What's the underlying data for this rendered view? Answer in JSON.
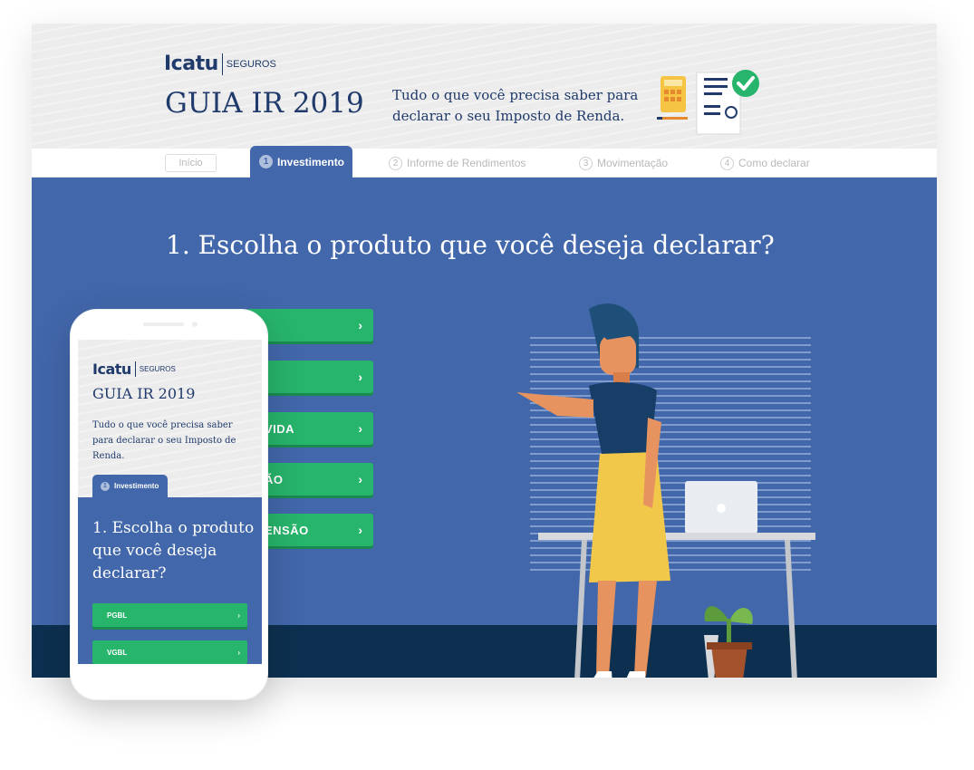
{
  "brand": {
    "name": "Icatu",
    "sub": "SEGUROS"
  },
  "header": {
    "title": "GUIA IR 2019",
    "tagline_line1": "Tudo o que você precisa saber para",
    "tagline_line2": "declarar o seu Imposto de Renda."
  },
  "nav": {
    "inicio": "Início",
    "steps": [
      {
        "num": "1",
        "label": "Investimento",
        "active": true
      },
      {
        "num": "2",
        "label": "Informe de Rendimentos",
        "active": false
      },
      {
        "num": "3",
        "label": "Movimentação",
        "active": false
      },
      {
        "num": "4",
        "label": "Como declarar",
        "active": false
      }
    ]
  },
  "main": {
    "question": "1. Escolha o produto que você deseja declarar?",
    "buttons_visible": [
      {
        "label": ""
      },
      {
        "label": ""
      },
      {
        "label": "VIDA"
      },
      {
        "label": "ÃO"
      },
      {
        "label": "ENSÃO"
      }
    ],
    "chevron": "›"
  },
  "mobile": {
    "title": "GUIA IR 2019",
    "tagline": "Tudo o que você precisa saber para declarar o seu Imposto de Renda.",
    "tab_num": "1",
    "tab_label": "Investimento",
    "question": "1. Escolha o produto que você deseja declarar?",
    "buttons": [
      {
        "label": "PGBL"
      },
      {
        "label": "VGBL"
      }
    ]
  },
  "colors": {
    "primary_blue": "#4267aa",
    "navy": "#1f3a6b",
    "green": "#27b46b",
    "dark_ground": "#0d3050",
    "header_bg": "#ececec"
  },
  "icons": [
    "calculator-icon",
    "document-check-icon",
    "chevron-right-icon"
  ]
}
